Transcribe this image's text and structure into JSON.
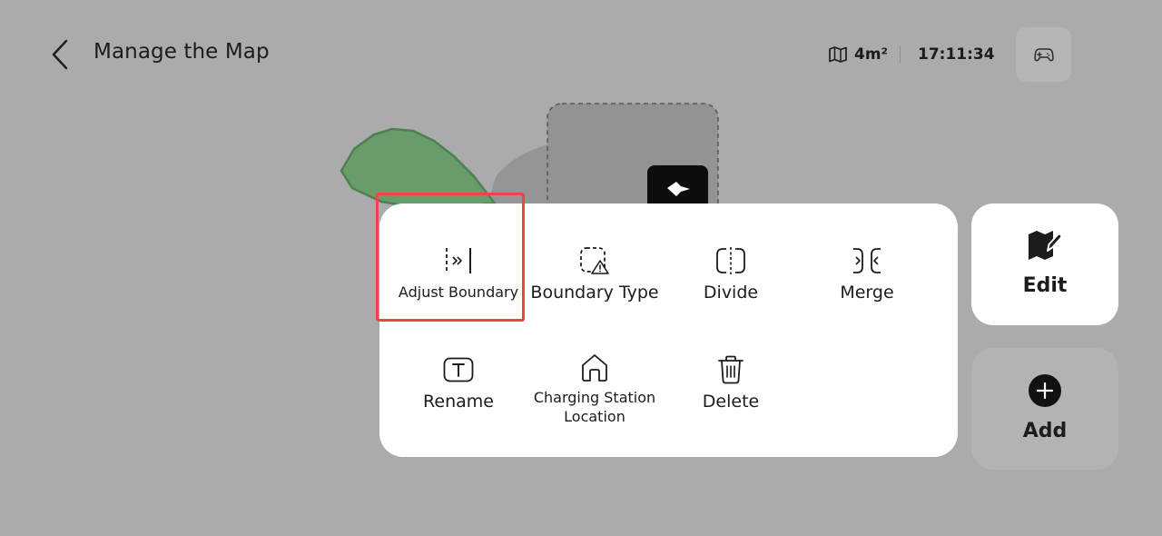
{
  "header": {
    "title": "Manage the Map",
    "area": "4m²",
    "time": "17:11:34",
    "back_icon": "chevron-left-icon",
    "gamepad_icon": "gamepad-icon"
  },
  "menu": {
    "items": [
      {
        "label": "Adjust Boundary",
        "icon": "adjust-boundary-icon",
        "highlighted": true
      },
      {
        "label": "Boundary Type",
        "icon": "boundary-type-icon"
      },
      {
        "label": "Divide",
        "icon": "divide-icon"
      },
      {
        "label": "Merge",
        "icon": "merge-icon"
      },
      {
        "label": "Rename",
        "icon": "rename-icon"
      },
      {
        "label": "Charging Station Location",
        "icon": "home-icon"
      },
      {
        "label": "Delete",
        "icon": "trash-icon"
      }
    ]
  },
  "side": {
    "edit_label": "Edit",
    "add_label": "Add"
  },
  "colors": {
    "background": "#abaaad",
    "zone_green": "#6a9c6a",
    "highlight": "#ef4444"
  }
}
